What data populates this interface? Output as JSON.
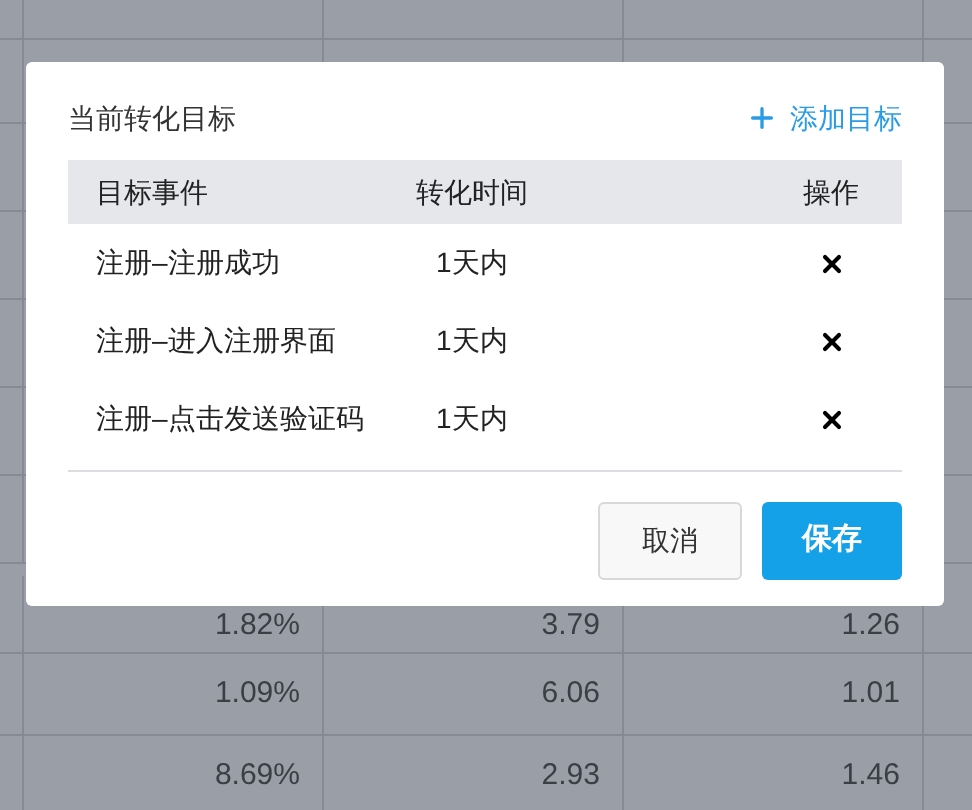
{
  "background_table": {
    "rows": [
      [
        "1.82%",
        "3.79",
        "1.26"
      ],
      [
        "1.09%",
        "6.06",
        "1.01"
      ],
      [
        "8.69%",
        "2.93",
        "1.46"
      ]
    ]
  },
  "dialog": {
    "title": "当前转化目标",
    "add_button": "添加目标",
    "table": {
      "columns": [
        "目标事件",
        "转化时间",
        "操作"
      ],
      "rows": [
        {
          "event": "注册–注册成功",
          "time": "1天内"
        },
        {
          "event": "注册–进入注册界面",
          "time": "1天内"
        },
        {
          "event": "注册–点击发送验证码",
          "time": "1天内"
        }
      ]
    },
    "buttons": {
      "cancel": "取消",
      "save": "保存"
    }
  }
}
